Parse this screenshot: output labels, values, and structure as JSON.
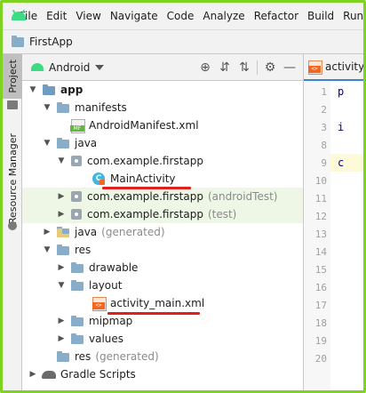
{
  "menubar": {
    "items": [
      "File",
      "Edit",
      "View",
      "Navigate",
      "Code",
      "Analyze",
      "Refactor",
      "Build",
      "Run"
    ]
  },
  "navbar": {
    "title": "FirstApp"
  },
  "toolstrip": {
    "project_tab": "Project",
    "resource_tab": "Resource Manager"
  },
  "panel": {
    "view_mode": "Android",
    "tools": [
      "crosshair-icon",
      "expand-all-icon",
      "collapse-all-icon",
      "gear-icon",
      "minimize-icon"
    ]
  },
  "tree": [
    {
      "label": "app",
      "suffix": "",
      "icon": "module-folder-icon",
      "expanded": true
    },
    {
      "label": "manifests",
      "suffix": "",
      "icon": "folder-icon",
      "expanded": true
    },
    {
      "label": "AndroidManifest.xml",
      "suffix": "",
      "icon": "manifest-file-icon"
    },
    {
      "label": "java",
      "suffix": "",
      "icon": "folder-icon",
      "expanded": true
    },
    {
      "label": "com.example.firstapp",
      "suffix": "",
      "icon": "package-icon",
      "expanded": true
    },
    {
      "label": "MainActivity",
      "suffix": "",
      "icon": "class-icon"
    },
    {
      "label": "com.example.firstapp",
      "suffix": "(androidTest)",
      "icon": "package-icon",
      "expanded": false
    },
    {
      "label": "com.example.firstapp",
      "suffix": "(test)",
      "icon": "package-icon",
      "expanded": false
    },
    {
      "label": "java",
      "suffix": "(generated)",
      "icon": "generated-folder-icon",
      "expanded": false
    },
    {
      "label": "res",
      "suffix": "",
      "icon": "folder-icon",
      "expanded": true
    },
    {
      "label": "drawable",
      "suffix": "",
      "icon": "folder-icon",
      "expanded": false
    },
    {
      "label": "layout",
      "suffix": "",
      "icon": "folder-icon",
      "expanded": true
    },
    {
      "label": "activity_main.xml",
      "suffix": "",
      "icon": "layout-xml-icon"
    },
    {
      "label": "mipmap",
      "suffix": "",
      "icon": "folder-icon",
      "expanded": false
    },
    {
      "label": "values",
      "suffix": "",
      "icon": "folder-icon",
      "expanded": false
    },
    {
      "label": "res",
      "suffix": "(generated)",
      "icon": "folder-icon"
    },
    {
      "label": "Gradle Scripts",
      "suffix": "",
      "icon": "gradle-icon",
      "expanded": false
    }
  ],
  "editor": {
    "tab_label": "activity_",
    "line_numbers": [
      "1",
      "2",
      "3",
      "8",
      "9",
      "10",
      "11",
      "12",
      "13",
      "14",
      "15",
      "16",
      "17",
      "18",
      "19",
      "20"
    ],
    "code_fragments": [
      "p",
      "i",
      "c"
    ]
  },
  "colors": {
    "frame_border": "#7ed321",
    "annotation_underline": "#e41e1e",
    "test_highlight": "#eef6e5"
  }
}
